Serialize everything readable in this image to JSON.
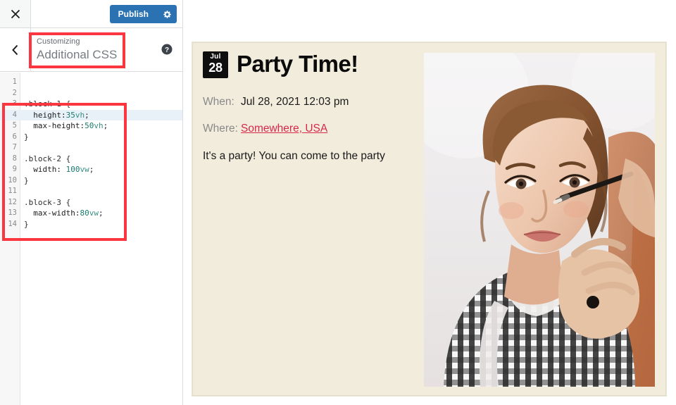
{
  "customizer": {
    "close_label": "close-icon",
    "publish_label": "Publish",
    "gear_label": "gear-icon",
    "back_label": "back-chevron-icon",
    "help_label": "help-icon",
    "breadcrumb_small": "Customizing",
    "breadcrumb_title": "Additional CSS",
    "accent_blue": "#2b72b3",
    "annotation_color": "#fb3640"
  },
  "editor": {
    "lines": [
      {
        "n": "1",
        "text": ""
      },
      {
        "n": "2",
        "text": ""
      },
      {
        "n": "3",
        "text": ".block-1 {"
      },
      {
        "n": "4",
        "text": "  height:35vh;",
        "active": true
      },
      {
        "n": "5",
        "text": "  max-height:50vh;"
      },
      {
        "n": "6",
        "text": "}"
      },
      {
        "n": "7",
        "text": ""
      },
      {
        "n": "8",
        "text": ".block-2 {"
      },
      {
        "n": "9",
        "text": "  width: 100vw;"
      },
      {
        "n": "10",
        "text": "}"
      },
      {
        "n": "11",
        "text": ""
      },
      {
        "n": "12",
        "text": ".block-3 {"
      },
      {
        "n": "13",
        "text": "  max-width:80vw;"
      },
      {
        "n": "14",
        "text": "}"
      }
    ]
  },
  "preview": {
    "event": {
      "badge_month": "Jul",
      "badge_day": "28",
      "title": "Party Time!",
      "when_label": "When:",
      "when_value": "Jul 28, 2021 12:03 pm",
      "where_label": "Where:",
      "where_value": "Somewhere, USA",
      "description": "It's a party! You can come to the party",
      "card_bg": "#f2ecdd",
      "link_color": "#d6294a"
    },
    "photo_alt": "makeup-artist-photo"
  }
}
